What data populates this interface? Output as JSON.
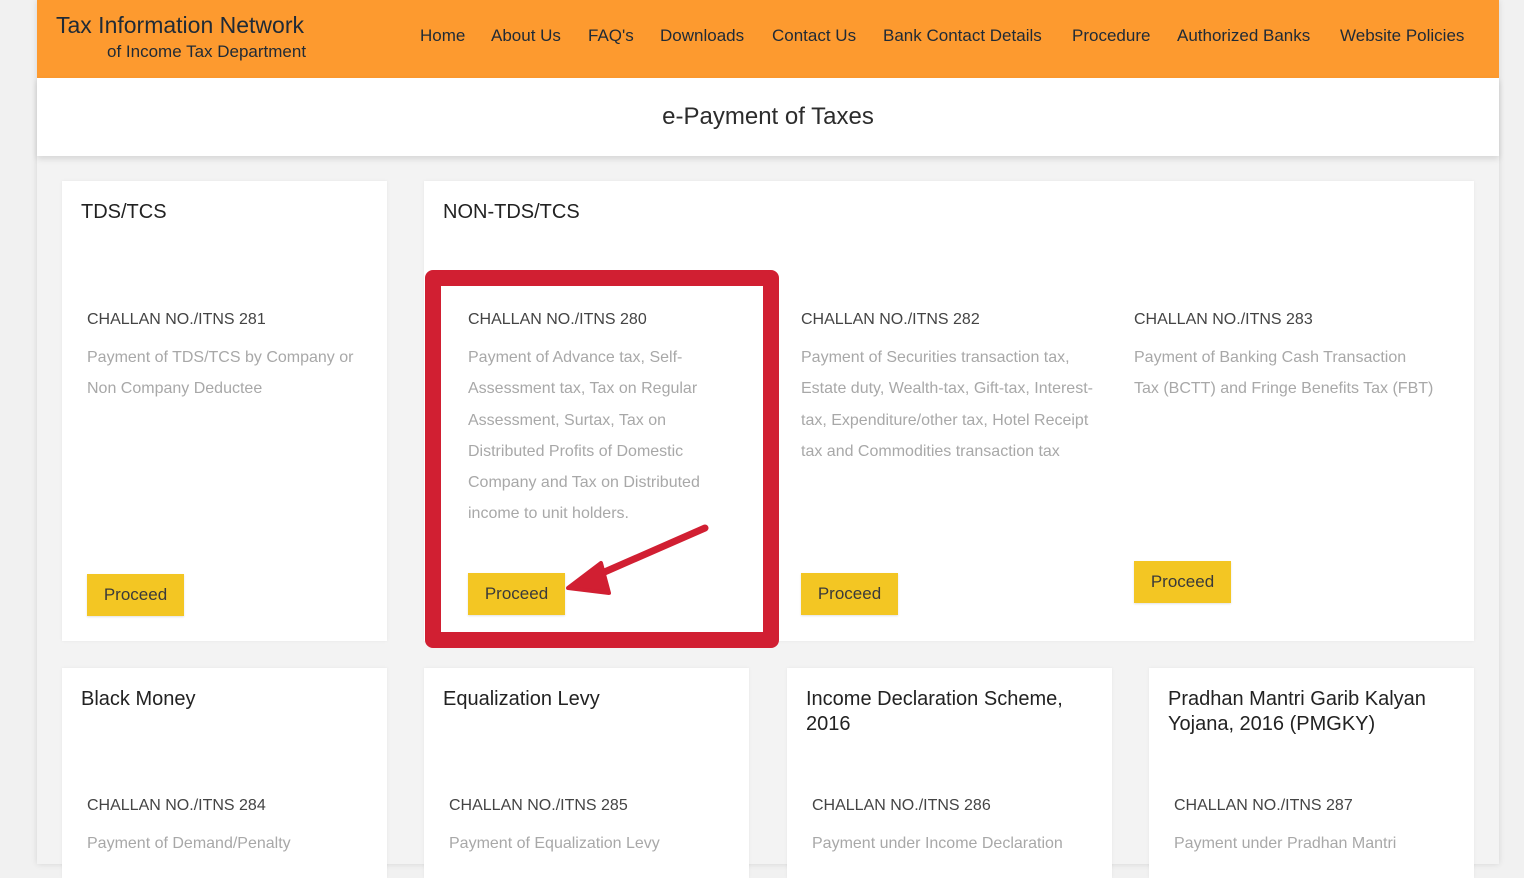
{
  "header": {
    "brand_line1": "Tax Information Network",
    "brand_line2": "of Income Tax Department",
    "nav": [
      {
        "label": "Home"
      },
      {
        "label": "About Us"
      },
      {
        "label": "FAQ's"
      },
      {
        "label": "Downloads"
      },
      {
        "label": "Contact Us"
      },
      {
        "label": "Bank Contact Details"
      },
      {
        "label": "Procedure"
      },
      {
        "label": "Authorized Banks"
      },
      {
        "label": "Website Policies"
      }
    ]
  },
  "page_title": "e-Payment of Taxes",
  "sections": {
    "tds": {
      "title": "TDS/TCS",
      "challan": "CHALLAN NO./ITNS 281",
      "description": "Payment of TDS/TCS by Company or Non Company Deductee",
      "button": "Proceed"
    },
    "non_tds": {
      "title": "NON-TDS/TCS",
      "items": [
        {
          "challan": "CHALLAN NO./ITNS 280",
          "description": "Payment of Advance tax, Self-Assessment tax, Tax on Regular Assessment, Surtax, Tax on Distributed Profits of Domestic Company and Tax on Distributed income to unit holders.",
          "button": "Proceed"
        },
        {
          "challan": "CHALLAN NO./ITNS 282",
          "description": "Payment of Securities transaction tax, Estate duty, Wealth-tax, Gift-tax, Interest-tax, Expenditure/other tax, Hotel Receipt tax and Commodities transaction tax",
          "button": "Proceed"
        },
        {
          "challan": "CHALLAN NO./ITNS 283",
          "description": "Payment of Banking Cash Transaction Tax (BCTT) and Fringe Benefits Tax (FBT)",
          "button": "Proceed"
        }
      ]
    },
    "black_money": {
      "title": "Black Money",
      "challan": "CHALLAN NO./ITNS 284",
      "description": "Payment of Demand/Penalty"
    },
    "equalization": {
      "title": "Equalization Levy",
      "challan": "CHALLAN NO./ITNS 285",
      "description": "Payment of Equalization Levy"
    },
    "ids": {
      "title": "Income Declaration Scheme, 2016",
      "challan": "CHALLAN NO./ITNS 286",
      "description": "Payment under Income Declaration"
    },
    "pmgky": {
      "title": "Pradhan Mantri Garib Kalyan Yojana, 2016 (PMGKY)",
      "challan": "CHALLAN NO./ITNS 287",
      "description": "Payment under Pradhan Mantri"
    }
  },
  "annotation": {
    "highlight_color": "#d11f32",
    "arrow_icon": "red-arrow-icon"
  },
  "colors": {
    "header_bg": "#fd9a2f",
    "button_bg": "#f3c623"
  }
}
